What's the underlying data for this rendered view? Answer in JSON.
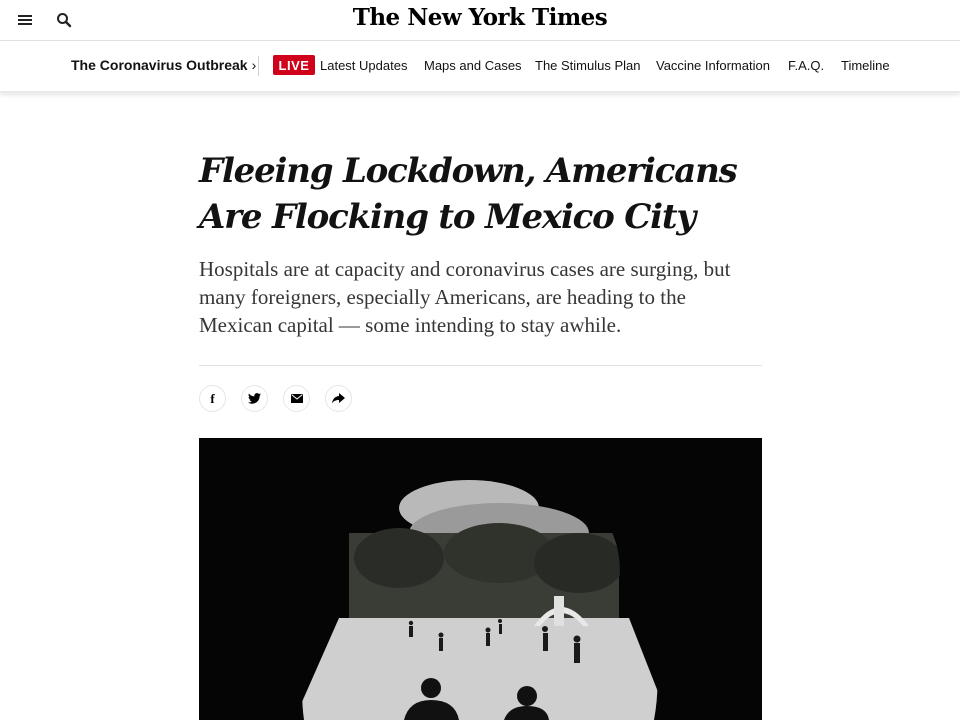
{
  "masthead": {
    "logo": "The New York Times",
    "menu_icon": "hamburger-menu-icon",
    "search_icon": "search-icon"
  },
  "subnav": {
    "section_title": "The Coronavirus Outbreak",
    "section_chevron": "›",
    "live_label": "LIVE",
    "live_color": "#d0021b",
    "links": [
      "Latest Updates",
      "Maps and Cases",
      "The Stimulus Plan",
      "Vaccine Information",
      "F.A.Q.",
      "Timeline"
    ]
  },
  "article": {
    "headline": "Fleeing Lockdown, Americans Are Flocking to Mexico City",
    "summary": "Hospitals are at capacity and coronavirus cases are surging, but many foreigners, especially Americans, are heading to the Mexican capital — some intending to stay awhile.",
    "share_buttons": [
      {
        "name": "facebook",
        "icon": "facebook-icon",
        "glyph": "f"
      },
      {
        "name": "twitter",
        "icon": "twitter-icon"
      },
      {
        "name": "email",
        "icon": "email-icon"
      },
      {
        "name": "share",
        "icon": "share-arrow-icon"
      }
    ],
    "photo": {
      "subject": "people playing in a plaza framed by dark tree foliage"
    }
  }
}
